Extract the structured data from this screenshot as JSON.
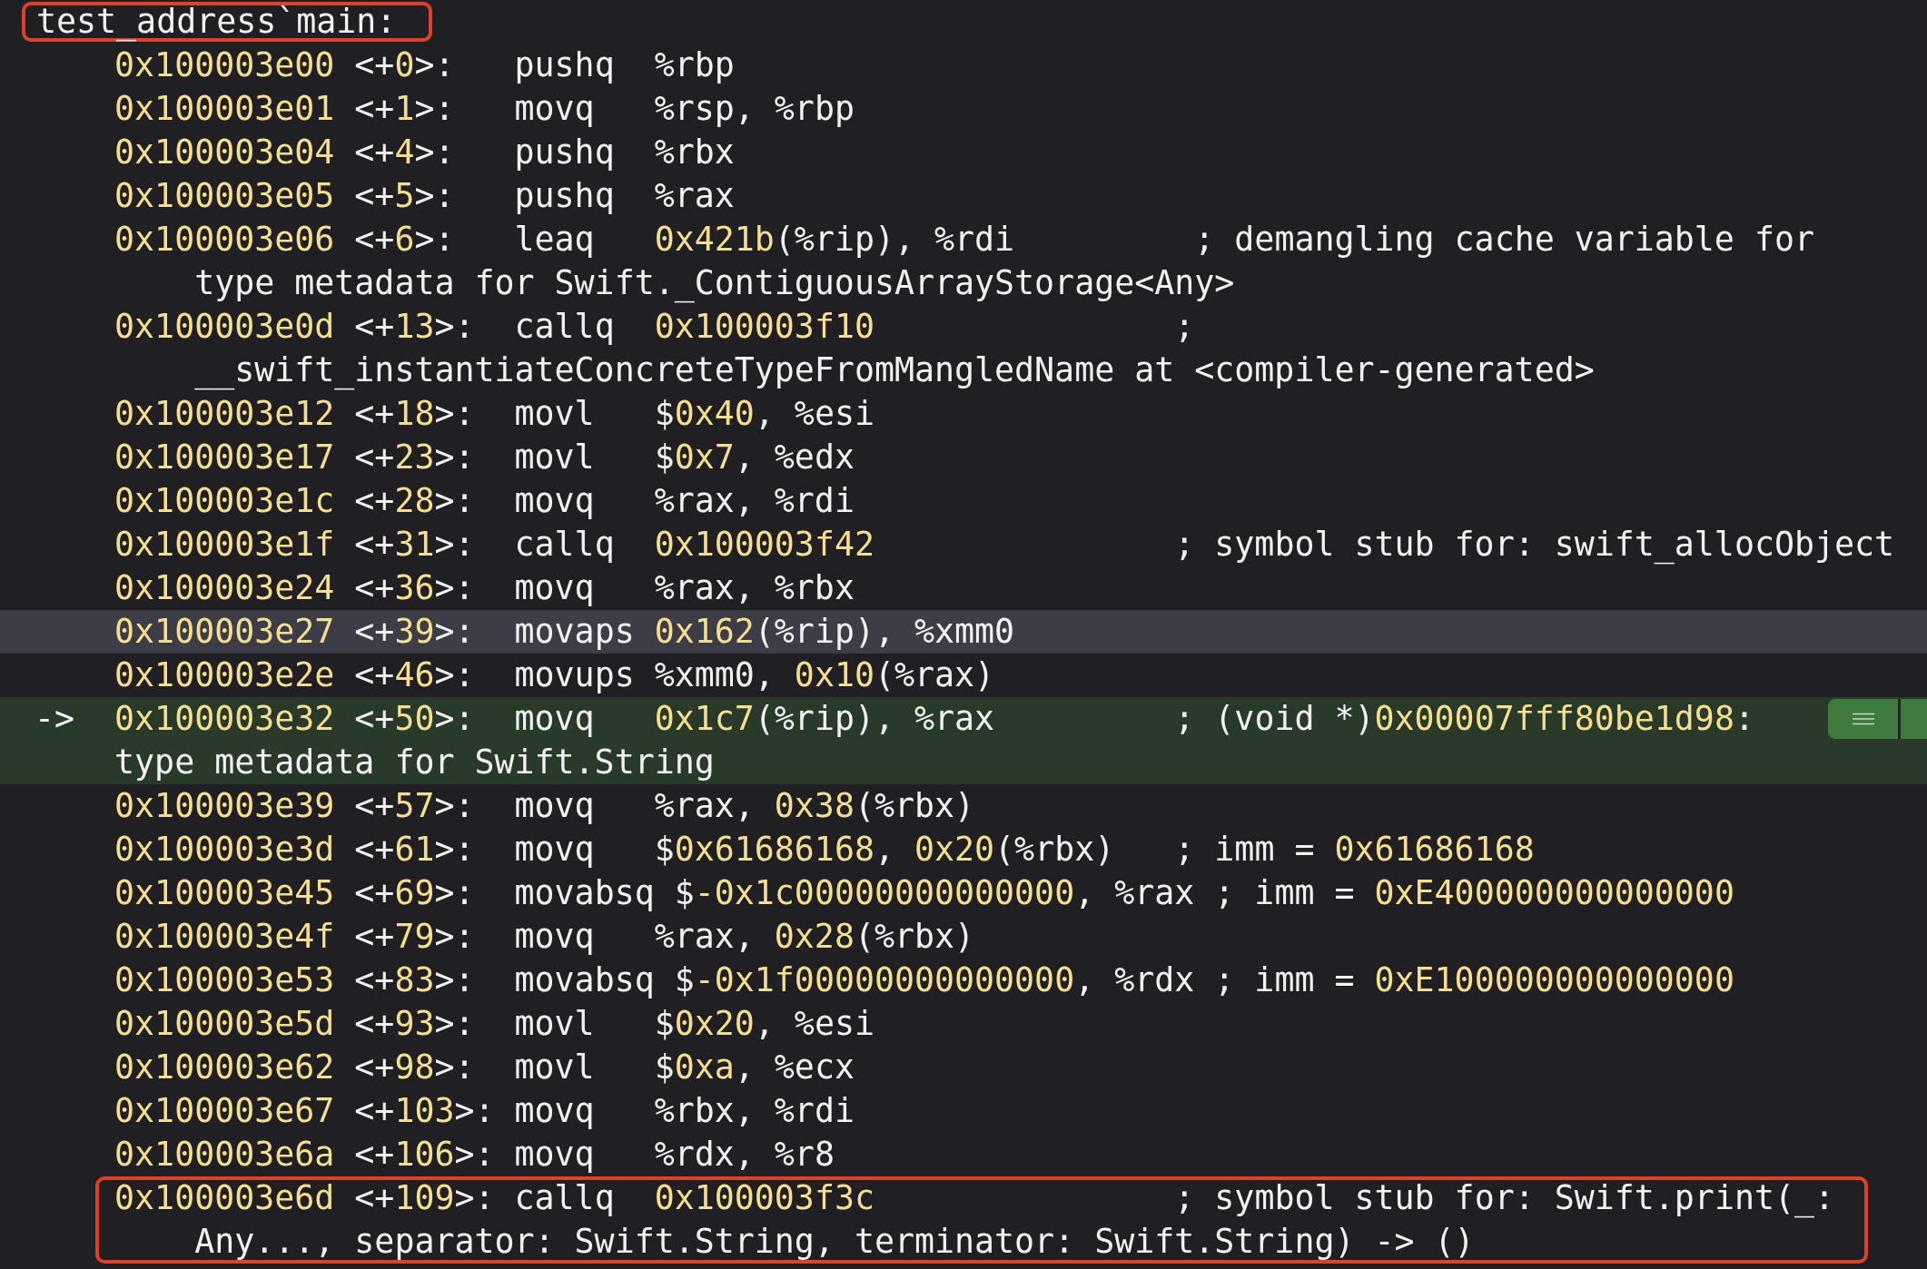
{
  "label": {
    "text": "test_address`main:",
    "boxed": true
  },
  "instructions": [
    {
      "selected": false,
      "current": false,
      "boxed": false,
      "segments": [
        {
          "kind": "number",
          "text": "0x100003e00"
        },
        {
          "kind": "plain",
          "text": " <+"
        },
        {
          "kind": "number",
          "text": "0"
        },
        {
          "kind": "plain",
          "text": ">:   pushq  %rbp"
        }
      ]
    },
    {
      "selected": false,
      "current": false,
      "boxed": false,
      "segments": [
        {
          "kind": "number",
          "text": "0x100003e01"
        },
        {
          "kind": "plain",
          "text": " <+"
        },
        {
          "kind": "number",
          "text": "1"
        },
        {
          "kind": "plain",
          "text": ">:   movq   %rsp, %rbp"
        }
      ]
    },
    {
      "selected": false,
      "current": false,
      "boxed": false,
      "segments": [
        {
          "kind": "number",
          "text": "0x100003e04"
        },
        {
          "kind": "plain",
          "text": " <+"
        },
        {
          "kind": "number",
          "text": "4"
        },
        {
          "kind": "plain",
          "text": ">:   pushq  %rbx"
        }
      ]
    },
    {
      "selected": false,
      "current": false,
      "boxed": false,
      "segments": [
        {
          "kind": "number",
          "text": "0x100003e05"
        },
        {
          "kind": "plain",
          "text": " <+"
        },
        {
          "kind": "number",
          "text": "5"
        },
        {
          "kind": "plain",
          "text": ">:   pushq  %rax"
        }
      ]
    },
    {
      "selected": false,
      "current": false,
      "boxed": false,
      "segments": [
        {
          "kind": "number",
          "text": "0x100003e06"
        },
        {
          "kind": "plain",
          "text": " <+"
        },
        {
          "kind": "number",
          "text": "6"
        },
        {
          "kind": "plain",
          "text": ">:   leaq   "
        },
        {
          "kind": "number",
          "text": "0x421b"
        },
        {
          "kind": "plain",
          "text": "(%rip), %rdi         ; demangling cache variable for"
        }
      ],
      "wrap": [
        {
          "kind": "plain",
          "text": "type metadata for Swift._ContiguousArrayStorage<Any>"
        }
      ]
    },
    {
      "selected": false,
      "current": false,
      "boxed": false,
      "segments": [
        {
          "kind": "number",
          "text": "0x100003e0d"
        },
        {
          "kind": "plain",
          "text": " <+"
        },
        {
          "kind": "number",
          "text": "13"
        },
        {
          "kind": "plain",
          "text": ">:  callq  "
        },
        {
          "kind": "number",
          "text": "0x100003f10"
        },
        {
          "kind": "plain",
          "text": "               ;"
        }
      ],
      "wrap": [
        {
          "kind": "plain",
          "text": "__swift_instantiateConcreteTypeFromMangledName at <compiler-generated>"
        }
      ]
    },
    {
      "selected": false,
      "current": false,
      "boxed": false,
      "segments": [
        {
          "kind": "number",
          "text": "0x100003e12"
        },
        {
          "kind": "plain",
          "text": " <+"
        },
        {
          "kind": "number",
          "text": "18"
        },
        {
          "kind": "plain",
          "text": ">:  movl   $"
        },
        {
          "kind": "number",
          "text": "0x40"
        },
        {
          "kind": "plain",
          "text": ", %esi"
        }
      ]
    },
    {
      "selected": false,
      "current": false,
      "boxed": false,
      "segments": [
        {
          "kind": "number",
          "text": "0x100003e17"
        },
        {
          "kind": "plain",
          "text": " <+"
        },
        {
          "kind": "number",
          "text": "23"
        },
        {
          "kind": "plain",
          "text": ">:  movl   $"
        },
        {
          "kind": "number",
          "text": "0x7"
        },
        {
          "kind": "plain",
          "text": ", %edx"
        }
      ]
    },
    {
      "selected": false,
      "current": false,
      "boxed": false,
      "segments": [
        {
          "kind": "number",
          "text": "0x100003e1c"
        },
        {
          "kind": "plain",
          "text": " <+"
        },
        {
          "kind": "number",
          "text": "28"
        },
        {
          "kind": "plain",
          "text": ">:  movq   %rax, %rdi"
        }
      ]
    },
    {
      "selected": false,
      "current": false,
      "boxed": false,
      "segments": [
        {
          "kind": "number",
          "text": "0x100003e1f"
        },
        {
          "kind": "plain",
          "text": " <+"
        },
        {
          "kind": "number",
          "text": "31"
        },
        {
          "kind": "plain",
          "text": ">:  callq  "
        },
        {
          "kind": "number",
          "text": "0x100003f42"
        },
        {
          "kind": "plain",
          "text": "               ; symbol stub for: swift_allocObject"
        }
      ]
    },
    {
      "selected": false,
      "current": false,
      "boxed": false,
      "segments": [
        {
          "kind": "number",
          "text": "0x100003e24"
        },
        {
          "kind": "plain",
          "text": " <+"
        },
        {
          "kind": "number",
          "text": "36"
        },
        {
          "kind": "plain",
          "text": ">:  movq   %rax, %rbx"
        }
      ]
    },
    {
      "selected": true,
      "current": false,
      "boxed": false,
      "segments": [
        {
          "kind": "number",
          "text": "0x100003e27"
        },
        {
          "kind": "plain",
          "text": " <+"
        },
        {
          "kind": "number",
          "text": "39"
        },
        {
          "kind": "plain",
          "text": ">:  movaps "
        },
        {
          "kind": "number",
          "text": "0x162"
        },
        {
          "kind": "plain",
          "text": "(%rip), %xmm0"
        }
      ]
    },
    {
      "selected": false,
      "current": false,
      "boxed": false,
      "segments": [
        {
          "kind": "number",
          "text": "0x100003e2e"
        },
        {
          "kind": "plain",
          "text": " <+"
        },
        {
          "kind": "number",
          "text": "46"
        },
        {
          "kind": "plain",
          "text": ">:  movups %xmm0, "
        },
        {
          "kind": "number",
          "text": "0x10"
        },
        {
          "kind": "plain",
          "text": "(%rax)"
        }
      ]
    },
    {
      "selected": false,
      "current": true,
      "boxed": false,
      "arrow": "->",
      "segments": [
        {
          "kind": "number",
          "text": "0x100003e32"
        },
        {
          "kind": "plain",
          "text": " <+"
        },
        {
          "kind": "number",
          "text": "50"
        },
        {
          "kind": "plain",
          "text": ">:  movq   "
        },
        {
          "kind": "number",
          "text": "0x1c7"
        },
        {
          "kind": "plain",
          "text": "(%rip), %rax         ; (void *)"
        },
        {
          "kind": "number",
          "text": "0x00007fff80be1d98"
        },
        {
          "kind": "plain",
          "text": ":"
        }
      ],
      "wrap": [
        {
          "kind": "plain",
          "text": "type metadata for Swift.String"
        }
      ]
    },
    {
      "selected": false,
      "current": false,
      "boxed": false,
      "segments": [
        {
          "kind": "number",
          "text": "0x100003e39"
        },
        {
          "kind": "plain",
          "text": " <+"
        },
        {
          "kind": "number",
          "text": "57"
        },
        {
          "kind": "plain",
          "text": ">:  movq   %rax, "
        },
        {
          "kind": "number",
          "text": "0x38"
        },
        {
          "kind": "plain",
          "text": "(%rbx)"
        }
      ]
    },
    {
      "selected": false,
      "current": false,
      "boxed": false,
      "segments": [
        {
          "kind": "number",
          "text": "0x100003e3d"
        },
        {
          "kind": "plain",
          "text": " <+"
        },
        {
          "kind": "number",
          "text": "61"
        },
        {
          "kind": "plain",
          "text": ">:  movq   $"
        },
        {
          "kind": "number",
          "text": "0x61686168"
        },
        {
          "kind": "plain",
          "text": ", "
        },
        {
          "kind": "number",
          "text": "0x20"
        },
        {
          "kind": "plain",
          "text": "(%rbx)   ; imm = "
        },
        {
          "kind": "number",
          "text": "0x61686168"
        }
      ]
    },
    {
      "selected": false,
      "current": false,
      "boxed": false,
      "segments": [
        {
          "kind": "number",
          "text": "0x100003e45"
        },
        {
          "kind": "plain",
          "text": " <+"
        },
        {
          "kind": "number",
          "text": "69"
        },
        {
          "kind": "plain",
          "text": ">:  movabsq $"
        },
        {
          "kind": "number",
          "text": "-0x1c00000000000000"
        },
        {
          "kind": "plain",
          "text": ", %rax ; imm = "
        },
        {
          "kind": "number",
          "text": "0xE400000000000000"
        }
      ]
    },
    {
      "selected": false,
      "current": false,
      "boxed": false,
      "segments": [
        {
          "kind": "number",
          "text": "0x100003e4f"
        },
        {
          "kind": "plain",
          "text": " <+"
        },
        {
          "kind": "number",
          "text": "79"
        },
        {
          "kind": "plain",
          "text": ">:  movq   %rax, "
        },
        {
          "kind": "number",
          "text": "0x28"
        },
        {
          "kind": "plain",
          "text": "(%rbx)"
        }
      ]
    },
    {
      "selected": false,
      "current": false,
      "boxed": false,
      "segments": [
        {
          "kind": "number",
          "text": "0x100003e53"
        },
        {
          "kind": "plain",
          "text": " <+"
        },
        {
          "kind": "number",
          "text": "83"
        },
        {
          "kind": "plain",
          "text": ">:  movabsq $"
        },
        {
          "kind": "number",
          "text": "-0x1f00000000000000"
        },
        {
          "kind": "plain",
          "text": ", %rdx ; imm = "
        },
        {
          "kind": "number",
          "text": "0xE100000000000000"
        }
      ]
    },
    {
      "selected": false,
      "current": false,
      "boxed": false,
      "segments": [
        {
          "kind": "number",
          "text": "0x100003e5d"
        },
        {
          "kind": "plain",
          "text": " <+"
        },
        {
          "kind": "number",
          "text": "93"
        },
        {
          "kind": "plain",
          "text": ">:  movl   $"
        },
        {
          "kind": "number",
          "text": "0x20"
        },
        {
          "kind": "plain",
          "text": ", %esi"
        }
      ]
    },
    {
      "selected": false,
      "current": false,
      "boxed": false,
      "segments": [
        {
          "kind": "number",
          "text": "0x100003e62"
        },
        {
          "kind": "plain",
          "text": " <+"
        },
        {
          "kind": "number",
          "text": "98"
        },
        {
          "kind": "plain",
          "text": ">:  movl   $"
        },
        {
          "kind": "number",
          "text": "0xa"
        },
        {
          "kind": "plain",
          "text": ", %ecx"
        }
      ]
    },
    {
      "selected": false,
      "current": false,
      "boxed": false,
      "segments": [
        {
          "kind": "number",
          "text": "0x100003e67"
        },
        {
          "kind": "plain",
          "text": " <+"
        },
        {
          "kind": "number",
          "text": "103"
        },
        {
          "kind": "plain",
          "text": ">: movq   %rbx, %rdi"
        }
      ]
    },
    {
      "selected": false,
      "current": false,
      "boxed": false,
      "segments": [
        {
          "kind": "number",
          "text": "0x100003e6a"
        },
        {
          "kind": "plain",
          "text": " <+"
        },
        {
          "kind": "number",
          "text": "106"
        },
        {
          "kind": "plain",
          "text": ">: movq   %rdx, %r8"
        }
      ]
    },
    {
      "selected": false,
      "current": false,
      "boxed": true,
      "segments": [
        {
          "kind": "number",
          "text": "0x100003e6d"
        },
        {
          "kind": "plain",
          "text": " <+"
        },
        {
          "kind": "number",
          "text": "109"
        },
        {
          "kind": "plain",
          "text": ">: callq  "
        },
        {
          "kind": "number",
          "text": "0x100003f3c"
        },
        {
          "kind": "plain",
          "text": "               ; symbol stub for: Swift.print(_:"
        }
      ],
      "wrap": [
        {
          "kind": "plain",
          "text": "Any..., separator: Swift.String, terminator: Swift.String) -> ()"
        }
      ]
    }
  ]
}
